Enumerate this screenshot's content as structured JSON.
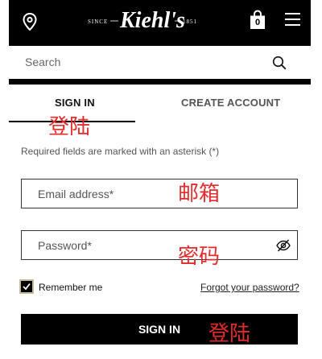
{
  "header": {
    "logo_since": "SINCE",
    "logo_brand": "Kiehl's",
    "logo_year": "1851",
    "bag_count": "0"
  },
  "search": {
    "placeholder": "Search"
  },
  "tabs": {
    "sign_in": "SIGN IN",
    "create_account": "CREATE ACCOUNT"
  },
  "form": {
    "required_note": "Required fields are marked with an asterisk (*)",
    "email_placeholder": "Email address*",
    "password_placeholder": "Password*",
    "remember_label": "Remember me",
    "remember_checked": true,
    "forgot_link": "Forgot your password?",
    "submit_label": "SIGN IN"
  },
  "annotations": {
    "signin_tab": "登陆",
    "email": "邮箱",
    "password": "密码",
    "signin_button": "登陆"
  },
  "colors": {
    "annotation": "#e52b2b",
    "bar": "#000000"
  }
}
